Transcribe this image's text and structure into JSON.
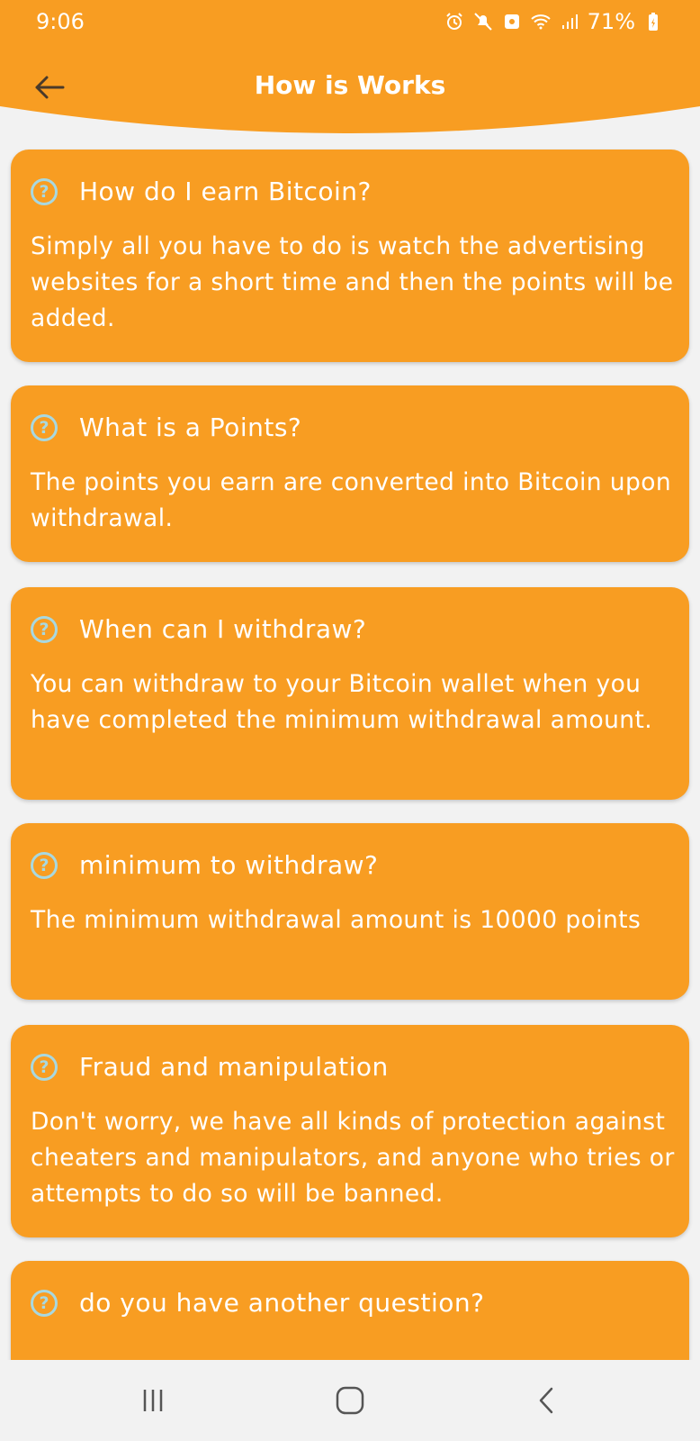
{
  "status": {
    "time": "9:06",
    "battery": "71%",
    "icons": [
      "alarm-icon",
      "mute-icon",
      "notification-icon",
      "wifi-icon",
      "signal-icon",
      "battery-charging-icon"
    ]
  },
  "header": {
    "title": "How is Works",
    "back_icon": "arrow-left-icon",
    "color": "#f89d22"
  },
  "faq": [
    {
      "question": "How do I earn Bitcoin?",
      "answer": "Simply all you have to do is watch the advertising websites for a short time and then the points will be added."
    },
    {
      "question": "What is a Points?",
      "answer": "The points you earn are converted into Bitcoin upon withdrawal."
    },
    {
      "question": "When can I withdraw?",
      "answer": "You can withdraw to your Bitcoin wallet when you have completed the minimum withdrawal amount."
    },
    {
      "question": "minimum to withdraw?",
      "answer": "The minimum withdrawal amount is 10000 points"
    },
    {
      "question": "Fraud and manipulation",
      "answer": "Don't worry, we have all kinds of protection against cheaters and manipulators, and anyone who tries or attempts to do so will be banned."
    },
    {
      "question": "do you have another question?",
      "answer": ""
    }
  ],
  "question_icon_color": "#a8d8e0",
  "navbar": {
    "icons": [
      "recent-apps-icon",
      "home-icon",
      "back-icon"
    ]
  }
}
